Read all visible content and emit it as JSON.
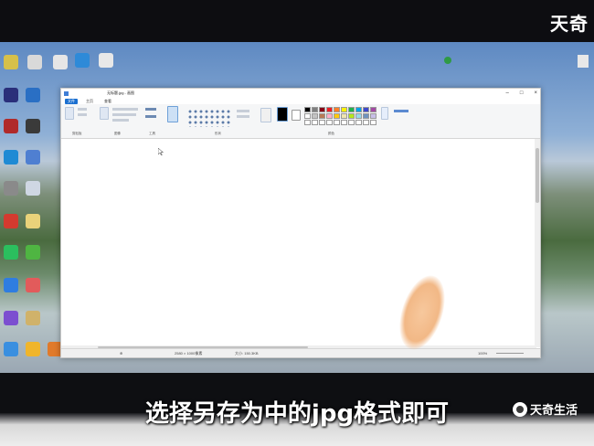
{
  "watermark": {
    "top_text": "天奇",
    "bottom_text": "天奇生活"
  },
  "caption": "选择另存为中的jpg格式即可",
  "paint": {
    "window_title": "无标题.jpg - 画图",
    "menu": [
      "文件",
      "主页",
      "查看"
    ],
    "ribbon_groups": [
      "剪贴板",
      "图像",
      "工具",
      "形状",
      "颜色"
    ],
    "status_size": "2580 × 1000像素",
    "status_size2": "大小: 150.3KB",
    "zoom": "100%"
  },
  "colors": {
    "palette": [
      "#000000",
      "#7f7f7f",
      "#880015",
      "#ed1c24",
      "#ff7f27",
      "#fff200",
      "#22b14c",
      "#00a2e8",
      "#3f48cc",
      "#a349a4",
      "#ffffff",
      "#c3c3c3",
      "#b97a57",
      "#ffaec9",
      "#ffc90e",
      "#efe4b0",
      "#b5e61d",
      "#99d9ea",
      "#7092be",
      "#c8bfe7",
      "#ffffff",
      "#ffffff",
      "#ffffff",
      "#ffffff",
      "#ffffff",
      "#ffffff",
      "#ffffff",
      "#ffffff",
      "#ffffff",
      "#ffffff"
    ],
    "accent": "#1a6fd0"
  }
}
